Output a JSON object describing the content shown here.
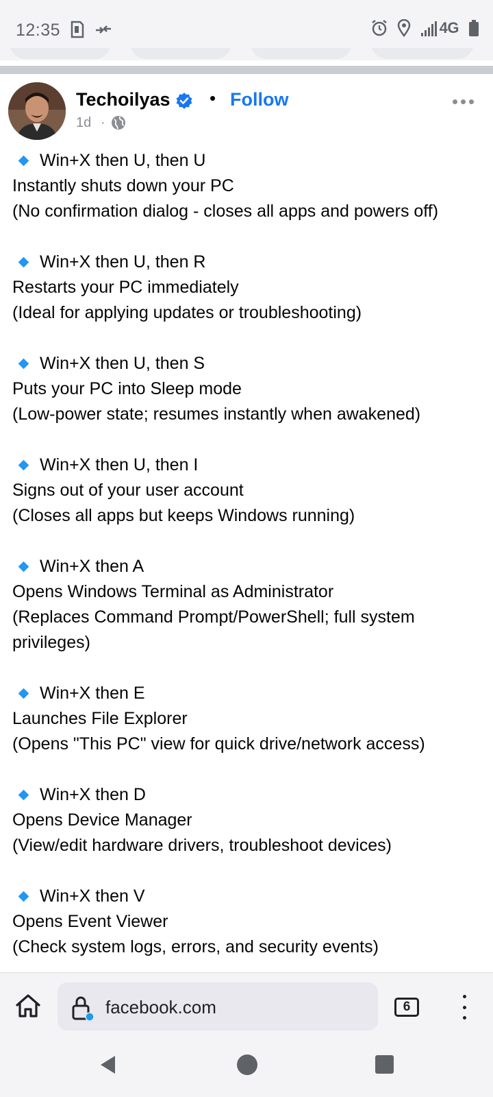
{
  "status_bar": {
    "time": "12:35",
    "network": "4G",
    "icons": [
      "sim-card-icon",
      "data-transfer-icon",
      "alarm-icon",
      "location-icon",
      "signal-icon",
      "battery-icon"
    ]
  },
  "post": {
    "author": "Techoilyas",
    "verified": true,
    "follow_label": "Follow",
    "separator": "•",
    "time": "1d",
    "time_separator": "·",
    "audience": "globe-icon",
    "tips": [
      {
        "keys": "Win+X then U, then U",
        "description": "Instantly shuts down your PC",
        "detail": "(No confirmation dialog - closes all apps and powers off)"
      },
      {
        "keys": "Win+X then U, then R",
        "description": "Restarts your PC immediately",
        "detail": "(Ideal for applying updates or troubleshooting)"
      },
      {
        "keys": "Win+X then U, then S",
        "description": "Puts your PC into Sleep mode",
        "detail": "(Low-power state; resumes instantly when awakened)"
      },
      {
        "keys": "Win+X then U, then I",
        "description": "Signs out of your user account",
        "detail": "(Closes all apps but keeps Windows running)"
      },
      {
        "keys": "Win+X then A",
        "description": "Opens Windows Terminal as Administrator",
        "detail": "(Replaces Command Prompt/PowerShell; full system privileges)"
      },
      {
        "keys": "Win+X then E",
        "description": "Launches File Explorer",
        "detail": "(Opens \"This PC\" view for quick drive/network access)"
      },
      {
        "keys": "Win+X then D",
        "description": "Opens Device Manager",
        "detail": "(View/edit hardware drivers, troubleshoot devices)"
      },
      {
        "keys": "Win+X then V",
        "description": "Opens Event Viewer",
        "detail": "(Check system logs, errors, and security events)"
      }
    ]
  },
  "browser": {
    "url": "facebook.com",
    "tab_count": "6"
  },
  "colors": {
    "accent": "#1877f2",
    "bullet": "#2196f3",
    "muted": "#8a8d91"
  }
}
